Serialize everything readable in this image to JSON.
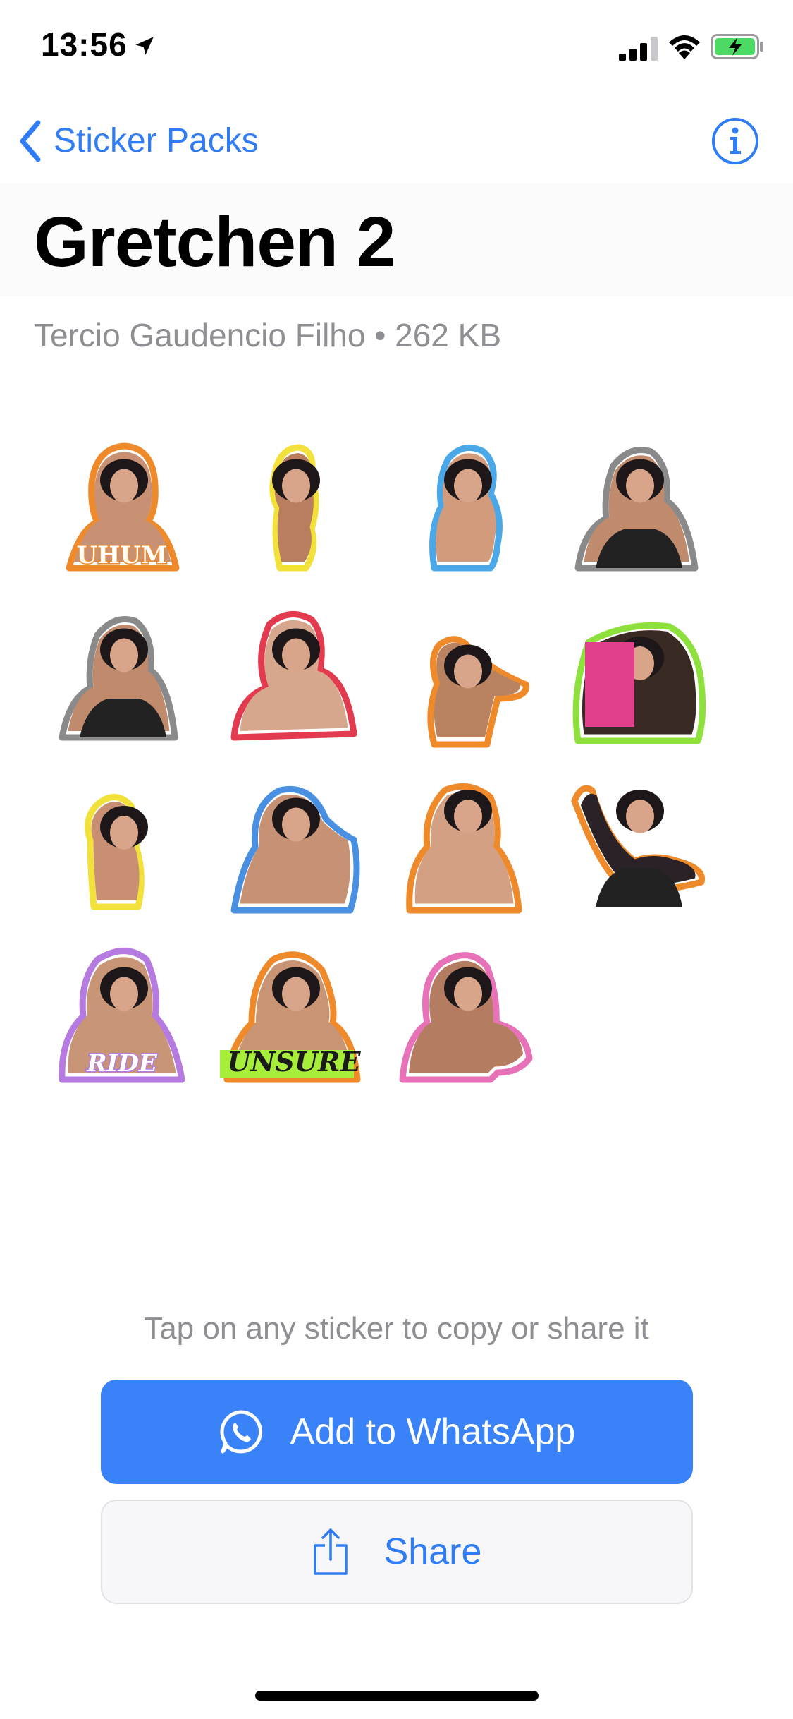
{
  "status_bar": {
    "time": "13:56",
    "icons": [
      "location-arrow-icon",
      "cellular-signal-icon",
      "wifi-icon",
      "battery-charging-icon"
    ]
  },
  "nav": {
    "back_label": "Sticker Packs",
    "info_icon": "info-icon"
  },
  "pack": {
    "title": "Gretchen 2",
    "subtitle": "Tercio Gaudencio Filho • 262 KB"
  },
  "stickers": [
    {
      "outline": "#ef8a2b",
      "caption": "UHUM"
    },
    {
      "outline": "#f2e13a",
      "caption": ""
    },
    {
      "outline": "#4aa8e8",
      "caption": ""
    },
    {
      "outline": "#8a8a8a",
      "caption": ""
    },
    {
      "outline": "#8a8a8a",
      "caption": ""
    },
    {
      "outline": "#e23b4f",
      "caption": ""
    },
    {
      "outline": "#ef8a2b",
      "caption": ""
    },
    {
      "outline": "#8ee13c",
      "caption": ""
    },
    {
      "outline": "#f2e13a",
      "caption": ""
    },
    {
      "outline": "#4a90e2",
      "caption": ""
    },
    {
      "outline": "#ef8a2b",
      "caption": ""
    },
    {
      "outline": "#ef8a2b",
      "caption": ""
    },
    {
      "outline": "#b57be0",
      "caption": "RIDE"
    },
    {
      "outline": "#ef8a2b",
      "caption": "UNSURE"
    },
    {
      "outline": "#e772b8",
      "caption": ""
    }
  ],
  "hint": "Tap on any sticker to copy or share it",
  "actions": {
    "add_label": "Add to WhatsApp",
    "add_icon": "whatsapp-icon",
    "share_label": "Share",
    "share_icon": "share-icon"
  },
  "colors": {
    "accent": "#2f7cf6",
    "primary_button": "#3a82f7",
    "secondary_text": "#8e8e93"
  }
}
